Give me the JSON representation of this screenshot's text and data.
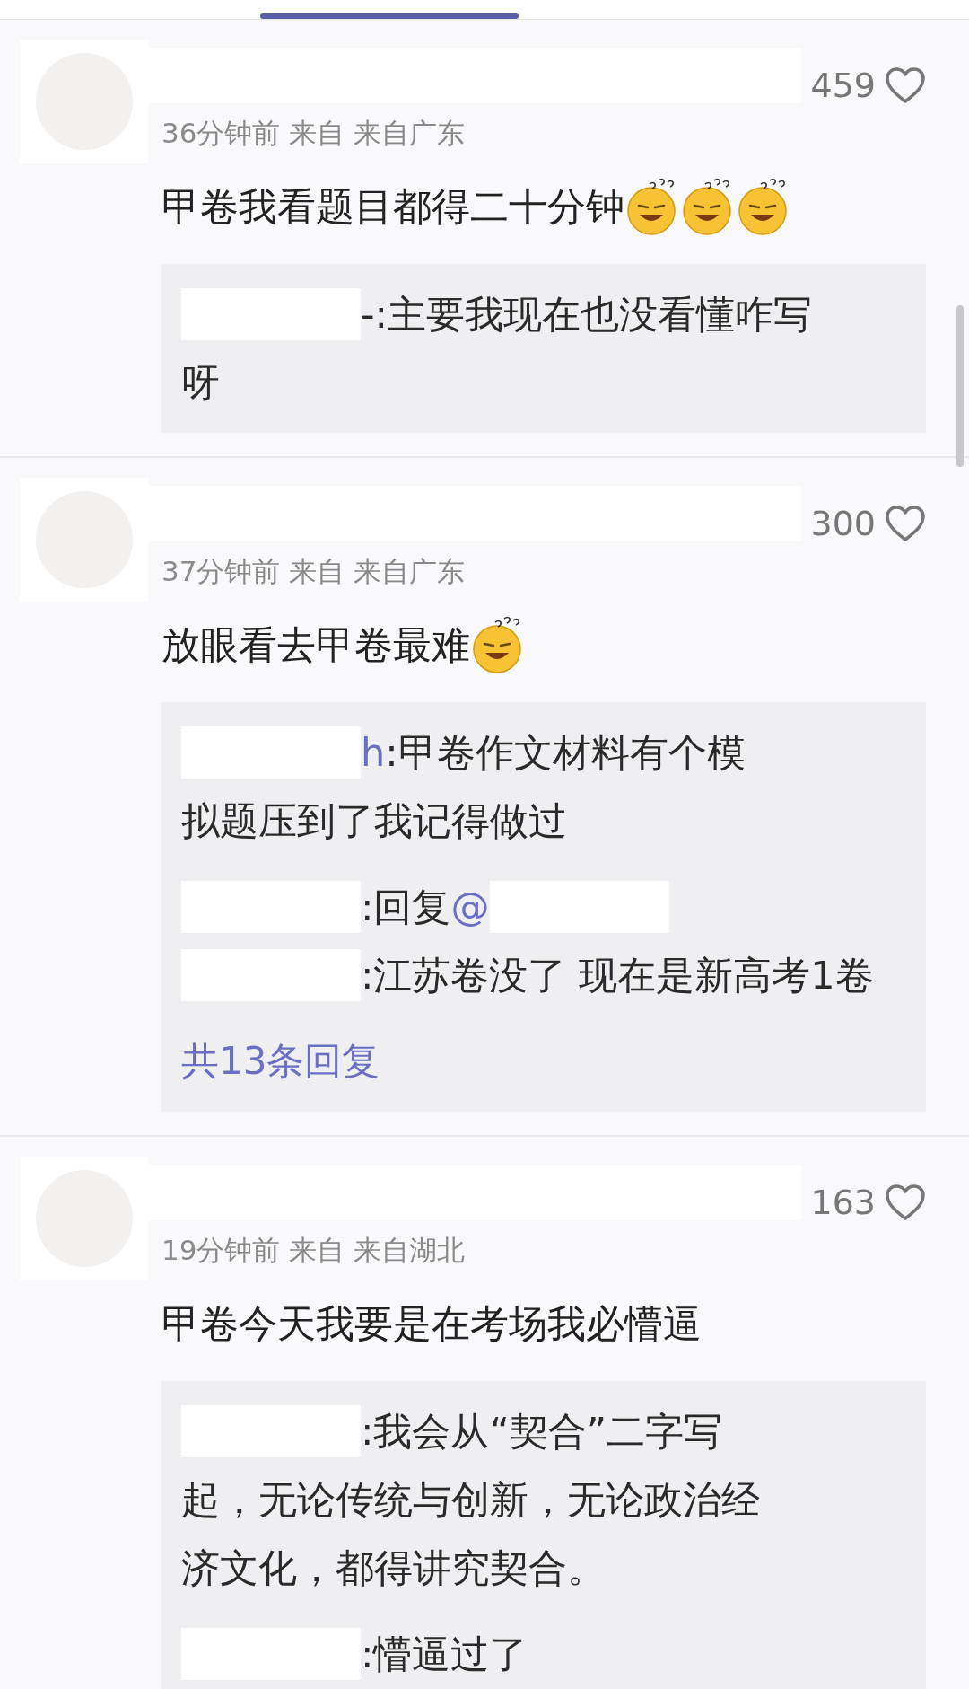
{
  "comments": [
    {
      "likes": "459",
      "meta": "36分钟前 来自 来自广东",
      "body": [
        {
          "kind": "text",
          "text": "甲卷我看题目都得二十分钟"
        },
        {
          "kind": "emoji"
        },
        {
          "kind": "emoji"
        },
        {
          "kind": "emoji"
        }
      ],
      "replies": [
        {
          "lines": [
            [
              {
                "kind": "redacted"
              },
              {
                "kind": "text",
                "text": "-:主要我现在也没看懂咋写"
              }
            ],
            [
              {
                "kind": "text",
                "text": "呀"
              }
            ]
          ]
        }
      ]
    },
    {
      "likes": "300",
      "meta": "37分钟前 来自 来自广东",
      "body": [
        {
          "kind": "text",
          "text": "放眼看去甲卷最难"
        },
        {
          "kind": "emoji"
        }
      ],
      "replies": [
        {
          "lines": [
            [
              {
                "kind": "redacted"
              },
              {
                "kind": "mention",
                "text": "h"
              },
              {
                "kind": "text",
                "text": ":甲卷作文材料有个模"
              }
            ],
            [
              {
                "kind": "text",
                "text": "拟题压到了我记得做过"
              }
            ]
          ]
        },
        {
          "lines": [
            [
              {
                "kind": "redacted"
              },
              {
                "kind": "text",
                "text": ":回复"
              },
              {
                "kind": "mention",
                "text": "@"
              },
              {
                "kind": "redacted"
              }
            ],
            [
              {
                "kind": "redacted"
              },
              {
                "kind": "text",
                "text": ":江苏卷没了 现在是新高考1卷"
              }
            ]
          ]
        }
      ],
      "more_replies": "共13条回复"
    },
    {
      "likes": "163",
      "meta": "19分钟前 来自 来自湖北",
      "body": [
        {
          "kind": "text",
          "text": "甲卷今天我要是在考场我必懵逼"
        }
      ],
      "replies": [
        {
          "lines": [
            [
              {
                "kind": "redacted"
              },
              {
                "kind": "text",
                "text": ":我会从“契合”二字写"
              }
            ],
            [
              {
                "kind": "text",
                "text": "起，无论传统与创新，无论政治经"
              }
            ],
            [
              {
                "kind": "text",
                "text": "济文化，都得讲究契合。"
              }
            ]
          ]
        },
        {
          "lines": [
            [
              {
                "kind": "redacted"
              },
              {
                "kind": "text",
                "text": ":懵逼过了"
              }
            ]
          ]
        }
      ]
    }
  ]
}
